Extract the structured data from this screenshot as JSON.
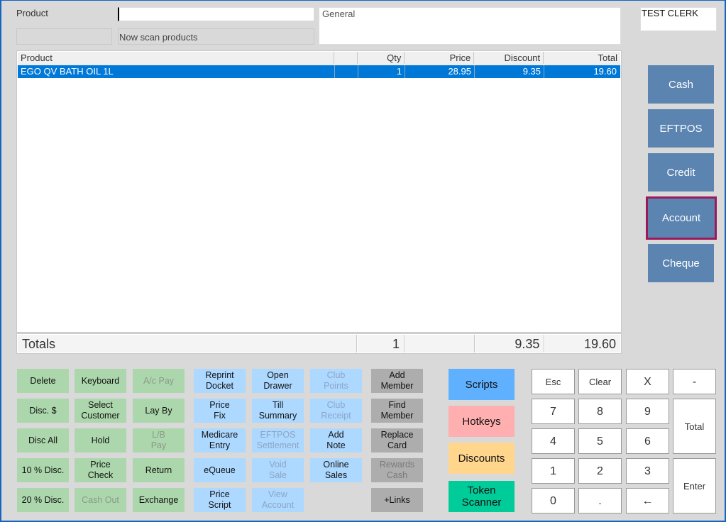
{
  "header": {
    "product_label": "Product",
    "product_input": "",
    "status": "Now scan products",
    "customer_note": "General",
    "clerk": "TEST CLERK"
  },
  "grid": {
    "columns": [
      "Product",
      "",
      "Qty",
      "Price",
      "Discount",
      "Total"
    ],
    "rows": [
      {
        "product": "EGO QV BATH OIL 1L",
        "blank": "",
        "qty": "1",
        "price": "28.95",
        "discount": "9.35",
        "total": "19.60"
      }
    ]
  },
  "totals": {
    "label": "Totals",
    "qty": "1",
    "price": "",
    "discount": "9.35",
    "total": "19.60"
  },
  "payment_buttons": [
    "Cash",
    "EFTPOS",
    "Credit",
    "Account",
    "Cheque"
  ],
  "function_buttons": [
    [
      {
        "label": "Delete",
        "style": "green",
        "enabled": true
      },
      {
        "label": "Disc. $",
        "style": "green",
        "enabled": true
      },
      {
        "label": "Disc All",
        "style": "green",
        "enabled": true
      },
      {
        "label": "10 % Disc.",
        "style": "green",
        "enabled": true
      },
      {
        "label": "20 % Disc.",
        "style": "green",
        "enabled": true
      }
    ],
    [
      {
        "label": "Keyboard",
        "style": "green",
        "enabled": true
      },
      {
        "label": "Select\nCustomer",
        "style": "green",
        "enabled": true
      },
      {
        "label": "Hold",
        "style": "green",
        "enabled": true
      },
      {
        "label": "Price\nCheck",
        "style": "green",
        "enabled": true
      },
      {
        "label": "Cash Out",
        "style": "green",
        "enabled": false
      }
    ],
    [
      {
        "label": "A/c Pay",
        "style": "green",
        "enabled": false
      },
      {
        "label": "Lay By",
        "style": "green",
        "enabled": true
      },
      {
        "label": "L/B\nPay",
        "style": "green",
        "enabled": false
      },
      {
        "label": "Return",
        "style": "green",
        "enabled": true
      },
      {
        "label": "Exchange",
        "style": "green",
        "enabled": true
      }
    ],
    [
      {
        "label": "Reprint\nDocket",
        "style": "blue",
        "enabled": true
      },
      {
        "label": "Price\nFix",
        "style": "blue",
        "enabled": true
      },
      {
        "label": "Medicare\nEntry",
        "style": "blue",
        "enabled": true
      },
      {
        "label": "eQueue",
        "style": "blue",
        "enabled": true
      },
      {
        "label": "Price\nScript",
        "style": "blue",
        "enabled": true
      }
    ],
    [
      {
        "label": "Open\nDrawer",
        "style": "blue",
        "enabled": true
      },
      {
        "label": "Till\nSummary",
        "style": "blue",
        "enabled": true
      },
      {
        "label": "EFTPOS\nSettlement",
        "style": "blue",
        "enabled": false
      },
      {
        "label": "Void\nSale",
        "style": "blue",
        "enabled": false
      },
      {
        "label": "View\nAccount",
        "style": "blue",
        "enabled": false
      }
    ],
    [
      {
        "label": "Club\nPoints",
        "style": "blue",
        "enabled": false
      },
      {
        "label": "Club\nReceipt",
        "style": "blue",
        "enabled": false
      },
      {
        "label": "Add\nNote",
        "style": "blue",
        "enabled": true
      },
      {
        "label": "Online\nSales",
        "style": "blue",
        "enabled": true
      },
      null
    ],
    [
      {
        "label": "Add\nMember",
        "style": "dark",
        "enabled": true
      },
      {
        "label": "Find\nMember",
        "style": "dark",
        "enabled": true
      },
      {
        "label": "Replace\nCard",
        "style": "dark",
        "enabled": true
      },
      {
        "label": "Rewards\nCash",
        "style": "dark",
        "enabled": false
      },
      {
        "label": "+Links",
        "style": "dark",
        "enabled": true
      }
    ]
  ],
  "menu_buttons": [
    {
      "label": "Scripts",
      "color": "#5fb0ff"
    },
    {
      "label": "Hotkeys",
      "color": "#ffafaf"
    },
    {
      "label": "Discounts",
      "color": "#ffd68c"
    },
    {
      "label": "Token\nScanner",
      "color": "#00cc99"
    }
  ],
  "keypad": [
    [
      "Esc",
      "Clear",
      "X",
      "-"
    ],
    [
      "7",
      "8",
      "9"
    ],
    [
      "4",
      "5",
      "6"
    ],
    [
      "1",
      "2",
      "3"
    ],
    [
      "0",
      ".",
      "←"
    ]
  ],
  "keypad_total": "Total",
  "keypad_enter": "Enter",
  "colors": {
    "selected_row": "#0078d7",
    "payment": "#5b84b1",
    "account_highlight": "#9c1a5b"
  }
}
